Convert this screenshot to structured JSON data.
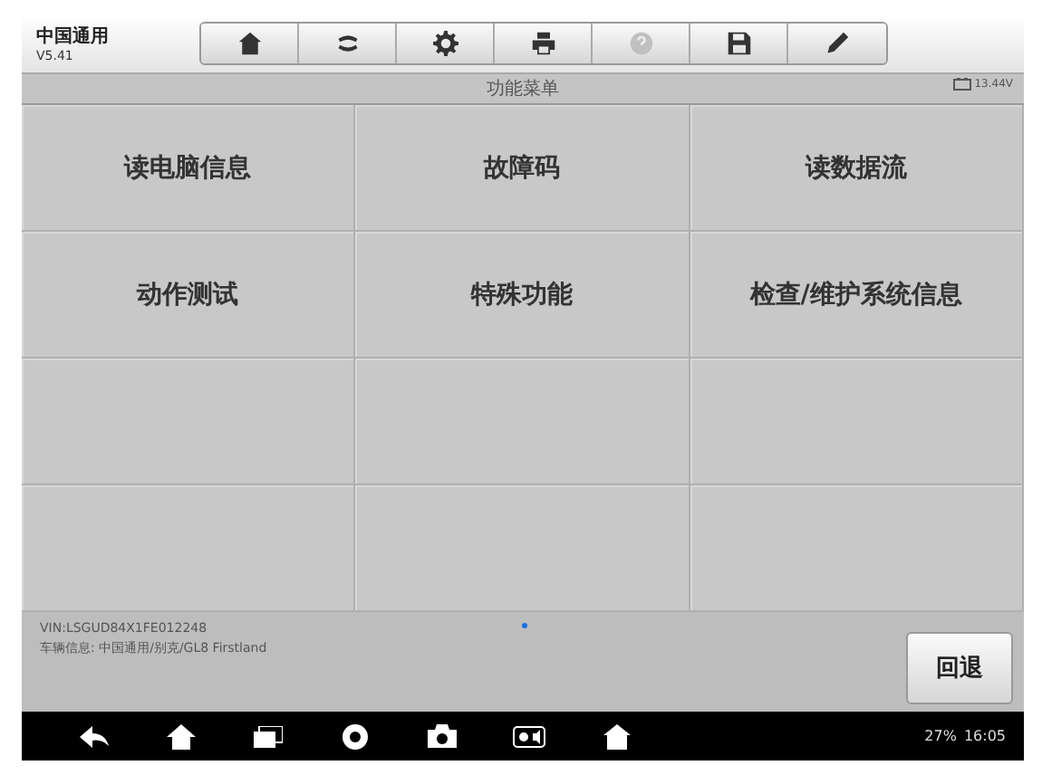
{
  "header": {
    "title": "中国通用",
    "version": "V5.41"
  },
  "toolbar": [
    {
      "kind": "home",
      "disabled": false
    },
    {
      "kind": "vehicle",
      "disabled": false
    },
    {
      "kind": "settings",
      "disabled": false
    },
    {
      "kind": "print",
      "disabled": false
    },
    {
      "kind": "help",
      "disabled": true
    },
    {
      "kind": "save",
      "disabled": false
    },
    {
      "kind": "edit",
      "disabled": false
    }
  ],
  "title_bar": {
    "title": "功能菜单",
    "voltage": "13.44V"
  },
  "menu": [
    {
      "label": "读电脑信息"
    },
    {
      "label": "故障码"
    },
    {
      "label": "读数据流"
    },
    {
      "label": "动作测试"
    },
    {
      "label": "特殊功能"
    },
    {
      "label": "检查/维护系统信息"
    }
  ],
  "footer": {
    "vin": "VIN:LSGUD84X1FE012248",
    "vehicle_info": "车辆信息: 中国通用/别克/GL8 Firstland",
    "back_button": "回退"
  },
  "nav_bar": {
    "battery": "27%",
    "time": "16:05"
  }
}
